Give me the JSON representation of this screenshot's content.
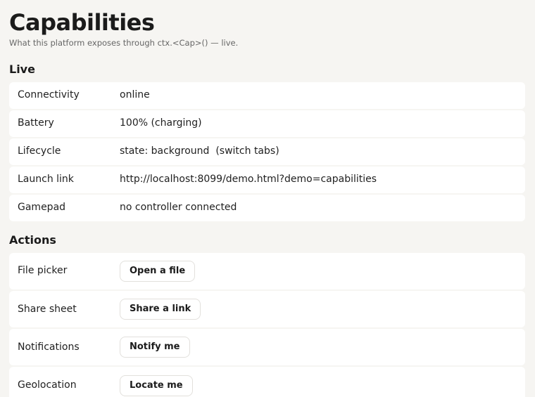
{
  "page": {
    "title": "Capabilities",
    "subtitle": "What this platform exposes through ctx.<Cap>() — live."
  },
  "live": {
    "heading": "Live",
    "rows": [
      {
        "label": "Connectivity",
        "value": "online"
      },
      {
        "label": "Battery",
        "value": "100% (charging)"
      },
      {
        "label": "Lifecycle",
        "value": "state: background  (switch tabs)"
      },
      {
        "label": "Launch link",
        "value": "http://localhost:8099/demo.html?demo=capabilities"
      },
      {
        "label": "Gamepad",
        "value": "no controller connected"
      }
    ]
  },
  "actions": {
    "heading": "Actions",
    "rows": [
      {
        "label": "File picker",
        "button": "Open a file"
      },
      {
        "label": "Share sheet",
        "button": "Share a link"
      },
      {
        "label": "Notifications",
        "button": "Notify me"
      },
      {
        "label": "Geolocation",
        "button": "Locate me"
      }
    ]
  }
}
